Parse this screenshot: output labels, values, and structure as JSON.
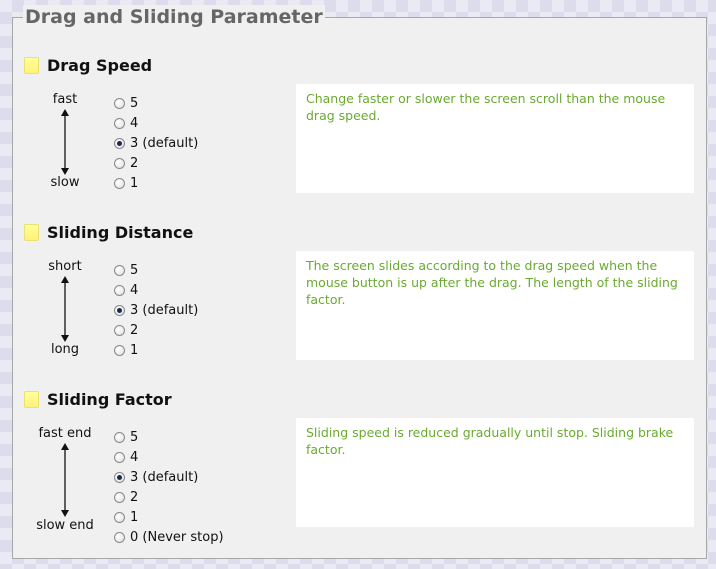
{
  "legend": "Drag and Sliding Parameter",
  "sections": [
    {
      "title": "Drag Speed",
      "axis_top": "fast",
      "axis_bottom": "slow",
      "options": [
        "5",
        "4",
        "3 (default)",
        "2",
        "1"
      ],
      "selected": "3 (default)",
      "description": "Change faster or slower the screen scroll than the mouse drag speed."
    },
    {
      "title": "Sliding Distance",
      "axis_top": "short",
      "axis_bottom": "long",
      "options": [
        "5",
        "4",
        "3 (default)",
        "2",
        "1"
      ],
      "selected": "3 (default)",
      "description": "The screen slides according to the drag speed when the mouse button is up after the drag. The length of the sliding factor."
    },
    {
      "title": "Sliding Factor",
      "axis_top": "fast end",
      "axis_bottom": "slow end",
      "options": [
        "5",
        "4",
        "3 (default)",
        "2",
        "1",
        "0 (Never stop)"
      ],
      "selected": "3 (default)",
      "description": "Sliding speed is reduced gradually until stop. Sliding brake factor."
    }
  ],
  "colors": {
    "description_text": "#6aaa30",
    "panel_background": "#f0f0f0",
    "legend_text": "#666666",
    "folder_icon": "#fff27a"
  }
}
